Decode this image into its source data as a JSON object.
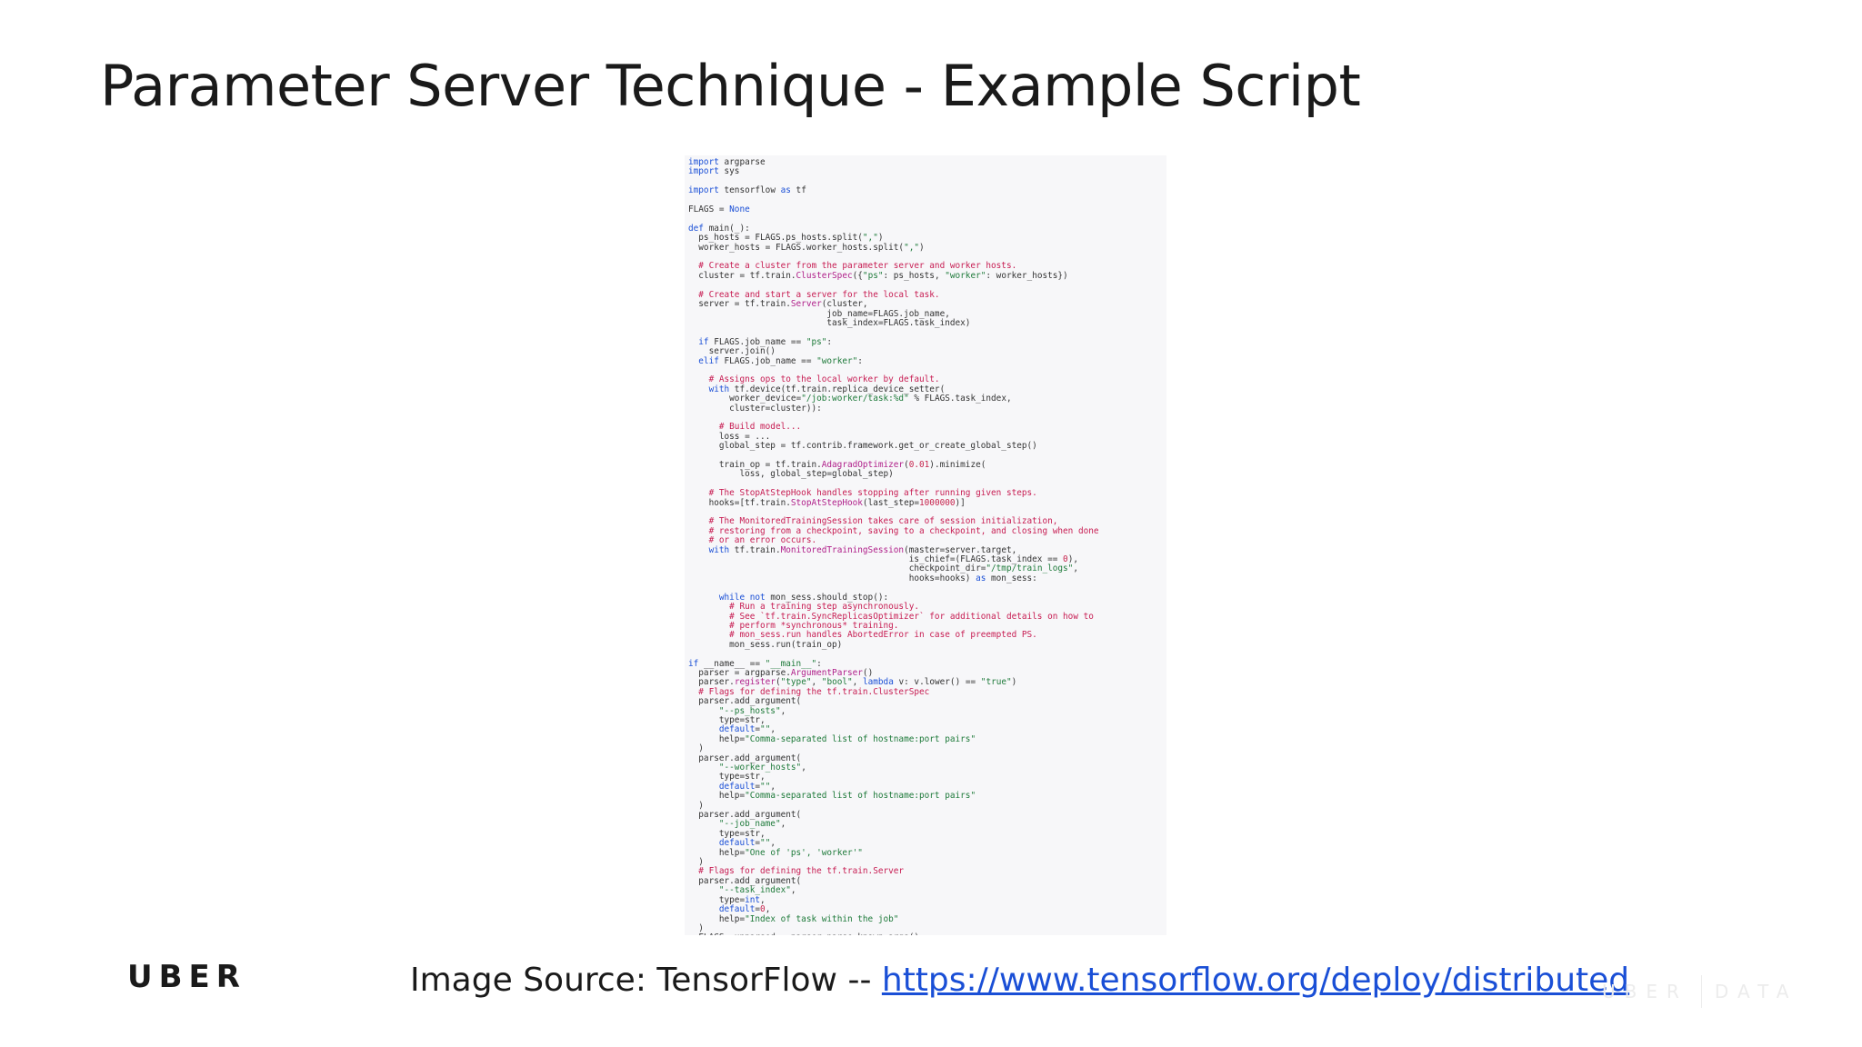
{
  "slide": {
    "title": "Parameter Server Technique - Example Script"
  },
  "code": [
    [
      [
        "kw",
        "import"
      ],
      [
        "t",
        " argparse"
      ]
    ],
    [
      [
        "kw",
        "import"
      ],
      [
        "t",
        " sys"
      ]
    ],
    [],
    [
      [
        "kw",
        "import"
      ],
      [
        "t",
        " tensorflow "
      ],
      [
        "kw",
        "as"
      ],
      [
        "t",
        " tf"
      ]
    ],
    [],
    [
      [
        "t",
        "FLAGS = "
      ],
      [
        "kw",
        "None"
      ]
    ],
    [],
    [
      [
        "kw",
        "def"
      ],
      [
        "t",
        " main(_):"
      ]
    ],
    [
      [
        "t",
        "  ps_hosts = FLAGS.ps_hosts.split("
      ],
      [
        "str",
        "\",\""
      ],
      [
        "t",
        ")"
      ]
    ],
    [
      [
        "t",
        "  worker_hosts = FLAGS.worker_hosts.split("
      ],
      [
        "str",
        "\",\""
      ],
      [
        "t",
        ")"
      ]
    ],
    [],
    [
      [
        "cm",
        "  # Create a cluster from the parameter server and worker hosts."
      ]
    ],
    [
      [
        "t",
        "  cluster = tf.train."
      ],
      [
        "fn",
        "ClusterSpec"
      ],
      [
        "t",
        "({"
      ],
      [
        "str",
        "\"ps\""
      ],
      [
        "t",
        ": ps_hosts, "
      ],
      [
        "str",
        "\"worker\""
      ],
      [
        "t",
        ": worker_hosts})"
      ]
    ],
    [],
    [
      [
        "cm",
        "  # Create and start a server for the local task."
      ]
    ],
    [
      [
        "t",
        "  server = tf.train."
      ],
      [
        "fn",
        "Server"
      ],
      [
        "t",
        "(cluster,"
      ]
    ],
    [
      [
        "t",
        "                           job_name=FLAGS.job_name,"
      ]
    ],
    [
      [
        "t",
        "                           task_index=FLAGS.task_index)"
      ]
    ],
    [],
    [
      [
        "kw",
        "  if"
      ],
      [
        "t",
        " FLAGS.job_name == "
      ],
      [
        "str",
        "\"ps\""
      ],
      [
        "t",
        ":"
      ]
    ],
    [
      [
        "t",
        "    server.join()"
      ]
    ],
    [
      [
        "kw",
        "  elif"
      ],
      [
        "t",
        " FLAGS.job_name == "
      ],
      [
        "str",
        "\"worker\""
      ],
      [
        "t",
        ":"
      ]
    ],
    [],
    [
      [
        "cm",
        "    # Assigns ops to the local worker by default."
      ]
    ],
    [
      [
        "kw",
        "    with"
      ],
      [
        "t",
        " tf.device(tf.train.replica_device_setter("
      ]
    ],
    [
      [
        "t",
        "        worker_device="
      ],
      [
        "str",
        "\"/job:worker/task:%d\""
      ],
      [
        "t",
        " % FLAGS.task_index,"
      ]
    ],
    [
      [
        "t",
        "        cluster=cluster)):"
      ]
    ],
    [],
    [
      [
        "cm",
        "      # Build model..."
      ]
    ],
    [
      [
        "t",
        "      loss = ..."
      ]
    ],
    [
      [
        "t",
        "      global_step = tf.contrib.framework.get_or_create_global_step()"
      ]
    ],
    [],
    [
      [
        "t",
        "      train_op = tf.train."
      ],
      [
        "fn",
        "AdagradOptimizer"
      ],
      [
        "t",
        "("
      ],
      [
        "num",
        "0.01"
      ],
      [
        "t",
        ").minimize("
      ]
    ],
    [
      [
        "t",
        "          loss, global_step=global_step)"
      ]
    ],
    [],
    [
      [
        "cm",
        "    # The StopAtStepHook handles stopping after running given steps."
      ]
    ],
    [
      [
        "t",
        "    hooks=[tf.train."
      ],
      [
        "fn",
        "StopAtStepHook"
      ],
      [
        "t",
        "(last_step="
      ],
      [
        "num",
        "1000000"
      ],
      [
        "t",
        ")]"
      ]
    ],
    [],
    [
      [
        "cm",
        "    # The MonitoredTrainingSession takes care of session initialization,"
      ]
    ],
    [
      [
        "cm",
        "    # restoring from a checkpoint, saving to a checkpoint, and closing when done"
      ]
    ],
    [
      [
        "cm",
        "    # or an error occurs."
      ]
    ],
    [
      [
        "kw",
        "    with"
      ],
      [
        "t",
        " tf.train."
      ],
      [
        "fn",
        "MonitoredTrainingSession"
      ],
      [
        "t",
        "(master=server.target,"
      ]
    ],
    [
      [
        "t",
        "                                           is_chief=(FLAGS.task_index == "
      ],
      [
        "num",
        "0"
      ],
      [
        "t",
        "),"
      ]
    ],
    [
      [
        "t",
        "                                           checkpoint_dir="
      ],
      [
        "str",
        "\"/tmp/train_logs\""
      ],
      [
        "t",
        ","
      ]
    ],
    [
      [
        "t",
        "                                           hooks=hooks) "
      ],
      [
        "kw",
        "as"
      ],
      [
        "t",
        " mon_sess:"
      ]
    ],
    [],
    [
      [
        "kw",
        "      while not"
      ],
      [
        "t",
        " mon_sess.should_stop():"
      ]
    ],
    [
      [
        "cm",
        "        # Run a training step asynchronously."
      ]
    ],
    [
      [
        "cm",
        "        # See `tf.train.SyncReplicasOptimizer` for additional details on how to"
      ]
    ],
    [
      [
        "cm",
        "        # perform *synchronous* training."
      ]
    ],
    [
      [
        "cm",
        "        # mon_sess.run handles AbortedError in case of preempted PS."
      ]
    ],
    [
      [
        "t",
        "        mon_sess.run(train_op)"
      ]
    ],
    [],
    [
      [
        "kw",
        "if"
      ],
      [
        "t",
        " __name__ == "
      ],
      [
        "str",
        "\"__main__\""
      ],
      [
        "t",
        ":"
      ]
    ],
    [
      [
        "t",
        "  parser = argparse."
      ],
      [
        "fn",
        "ArgumentParser"
      ],
      [
        "t",
        "()"
      ]
    ],
    [
      [
        "t",
        "  parser."
      ],
      [
        "fn",
        "register"
      ],
      [
        "t",
        "("
      ],
      [
        "str",
        "\"type\""
      ],
      [
        "t",
        ", "
      ],
      [
        "str",
        "\"bool\""
      ],
      [
        "t",
        ", "
      ],
      [
        "kw",
        "lambda"
      ],
      [
        "t",
        " v: v.lower() == "
      ],
      [
        "str",
        "\"true\""
      ],
      [
        "t",
        ")"
      ]
    ],
    [
      [
        "cm",
        "  # Flags for defining the tf.train.ClusterSpec"
      ]
    ],
    [
      [
        "t",
        "  parser.add_argument("
      ]
    ],
    [
      [
        "str",
        "      \"--ps_hosts\""
      ],
      [
        "t",
        ","
      ]
    ],
    [
      [
        "t",
        "      type=str,"
      ]
    ],
    [
      [
        "t",
        "      "
      ],
      [
        "kw",
        "default"
      ],
      [
        "t",
        "="
      ],
      [
        "str",
        "\"\""
      ],
      [
        "t",
        ","
      ]
    ],
    [
      [
        "t",
        "      help="
      ],
      [
        "str",
        "\"Comma-separated list of hostname:port pairs\""
      ]
    ],
    [
      [
        "t",
        "  )"
      ]
    ],
    [
      [
        "t",
        "  parser.add_argument("
      ]
    ],
    [
      [
        "str",
        "      \"--worker_hosts\""
      ],
      [
        "t",
        ","
      ]
    ],
    [
      [
        "t",
        "      type=str,"
      ]
    ],
    [
      [
        "t",
        "      "
      ],
      [
        "kw",
        "default"
      ],
      [
        "t",
        "="
      ],
      [
        "str",
        "\"\""
      ],
      [
        "t",
        ","
      ]
    ],
    [
      [
        "t",
        "      help="
      ],
      [
        "str",
        "\"Comma-separated list of hostname:port pairs\""
      ]
    ],
    [
      [
        "t",
        "  )"
      ]
    ],
    [
      [
        "t",
        "  parser.add_argument("
      ]
    ],
    [
      [
        "str",
        "      \"--job_name\""
      ],
      [
        "t",
        ","
      ]
    ],
    [
      [
        "t",
        "      type=str,"
      ]
    ],
    [
      [
        "t",
        "      "
      ],
      [
        "kw",
        "default"
      ],
      [
        "t",
        "="
      ],
      [
        "str",
        "\"\""
      ],
      [
        "t",
        ","
      ]
    ],
    [
      [
        "t",
        "      help="
      ],
      [
        "str",
        "\"One of 'ps', 'worker'\""
      ]
    ],
    [
      [
        "t",
        "  )"
      ]
    ],
    [
      [
        "cm",
        "  # Flags for defining the tf.train.Server"
      ]
    ],
    [
      [
        "t",
        "  parser.add_argument("
      ]
    ],
    [
      [
        "str",
        "      \"--task_index\""
      ],
      [
        "t",
        ","
      ]
    ],
    [
      [
        "t",
        "      type="
      ],
      [
        "kw",
        "int"
      ],
      [
        "t",
        ","
      ]
    ],
    [
      [
        "t",
        "      "
      ],
      [
        "kw",
        "default"
      ],
      [
        "t",
        "="
      ],
      [
        "num",
        "0"
      ],
      [
        "t",
        ","
      ]
    ],
    [
      [
        "t",
        "      help="
      ],
      [
        "str",
        "\"Index of task within the job\""
      ]
    ],
    [
      [
        "t",
        "  )"
      ]
    ],
    [
      [
        "t",
        "  FLAGS, unparsed = parser.parse_known_args()"
      ]
    ]
  ],
  "branding": {
    "logo_text": "UBER",
    "watermark_left": "UBER",
    "watermark_right": "DATA"
  },
  "caption": {
    "prefix": "Image Source: TensorFlow -- ",
    "link_text": "https://www.tensorflow.org/deploy/distributed"
  },
  "colors": {
    "keyword": "#1a4fd6",
    "string": "#1e7a3a",
    "comment": "#c71c52",
    "function": "#b0208a",
    "number": "#c7254e",
    "link": "#1a4fd6"
  }
}
